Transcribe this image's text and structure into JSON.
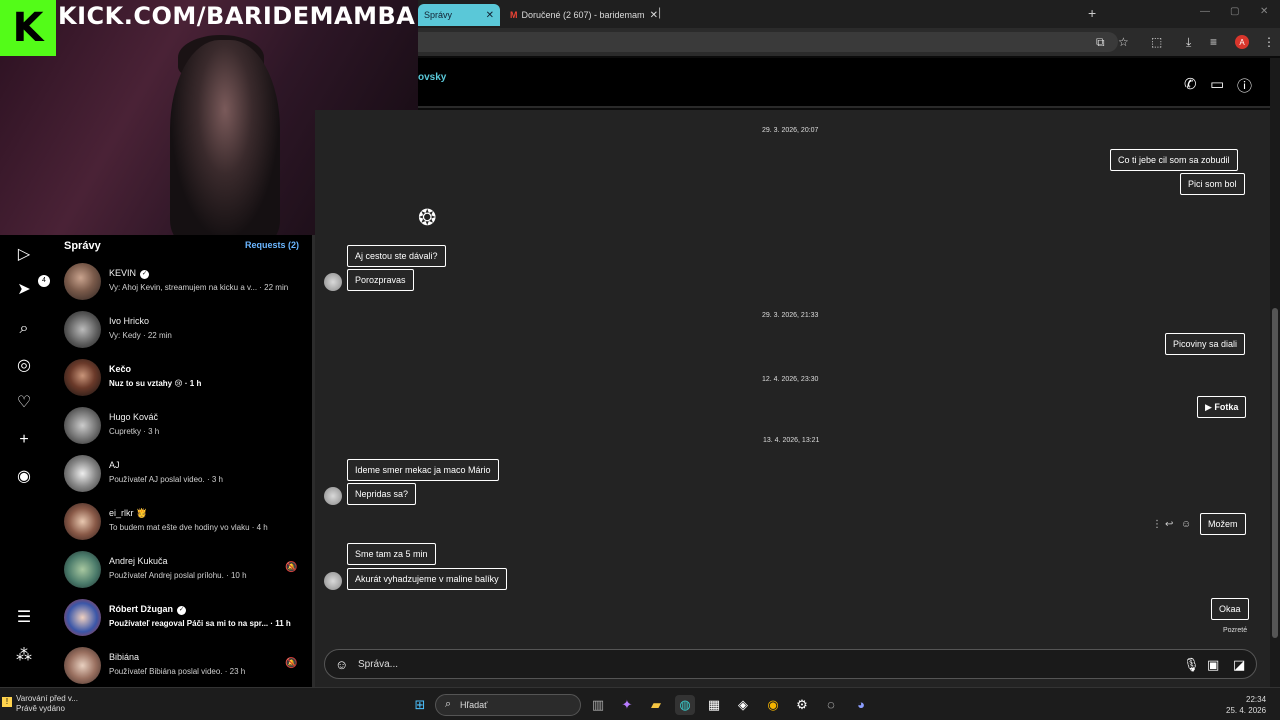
{
  "stream": {
    "kick_logo": "K",
    "banner": "KICK.COM/BARIDEMAMBA"
  },
  "browser": {
    "tabs": [
      {
        "label": "Správy",
        "active": true
      },
      {
        "label": "Doručené (2 607) - baridemam",
        "active": false
      }
    ],
    "new_tab": "+",
    "profile_initial": "A"
  },
  "nav": {
    "icons": [
      "reels-icon",
      "messenger-icon",
      "search-icon",
      "explore-icon",
      "heart-icon",
      "plus-icon",
      "profile-icon",
      "menu-icon",
      "meta-icon"
    ],
    "messenger_badge": "4"
  },
  "messages_panel": {
    "title": "Správy",
    "requests": "Requests (2)",
    "conversations": [
      {
        "name": "KEVIN",
        "verified": true,
        "preview": "Vy: Ahoj Kevin, streamujem na kicku a v... · 22 min",
        "bold": false,
        "muted": false
      },
      {
        "name": "Ivo Hricko",
        "verified": false,
        "preview": "Vy: Kedy · 22 min",
        "bold": false,
        "muted": false
      },
      {
        "name": "Kečo",
        "verified": false,
        "preview": "Nuz to su vztahy 😢 · 1 h",
        "bold": true,
        "muted": false
      },
      {
        "name": "Hugo Kováč",
        "verified": false,
        "preview": "Cupretky · 3 h",
        "bold": false,
        "muted": false
      },
      {
        "name": "AJ",
        "verified": false,
        "preview": "Používateľ AJ poslal video. · 3 h",
        "bold": false,
        "muted": false
      },
      {
        "name": "ei_rlkr 🫅",
        "verified": false,
        "preview": "To budem mat ešte dve hodiny vo vlaku · 4 h",
        "bold": false,
        "muted": false
      },
      {
        "name": "Andrej Kukuča",
        "verified": false,
        "preview": "Používateľ Andrej poslal prílohu. · 10 h",
        "bold": false,
        "muted": true
      },
      {
        "name": "Róbert Džugan",
        "verified": true,
        "preview": "Používateľ reagoval Páči sa mi to na spr... · 11 h",
        "bold": true,
        "muted": false
      },
      {
        "name": "Bibiána",
        "verified": false,
        "preview": "Používateľ Bibiána poslal video. · 23 h",
        "bold": false,
        "muted": true
      }
    ]
  },
  "chat": {
    "name": "ovsky",
    "dates": [
      "29. 3. 2026, 20:07",
      "29. 3. 2026, 21:33",
      "12. 4. 2026, 23:30",
      "13. 4. 2026, 13:21"
    ],
    "messages": {
      "m1": "Co ti jebe cil som sa zobudil",
      "m2": "Pici som bol",
      "m3": "Aj cestou ste dávali?",
      "m4": "Porozpravas",
      "m5": "Picoviny sa diali",
      "m6": "▶ Fotka",
      "m7": "Ideme smer mekac ja maco Mário",
      "m8": "Nepridas sa?",
      "m9": "Možem",
      "m10": "Sme tam za 5 min",
      "m11": "Akurát vyhadzujeme v maline balíky",
      "m12": "Okaa"
    },
    "seen": "Pozreté",
    "composer_placeholder": "Správa..."
  },
  "taskbar": {
    "warning_title": "Varování před v...",
    "warning_sub": "Právě vydáno",
    "search": "Hľadať",
    "time": "22:34",
    "date": "25. 4. 2026"
  }
}
